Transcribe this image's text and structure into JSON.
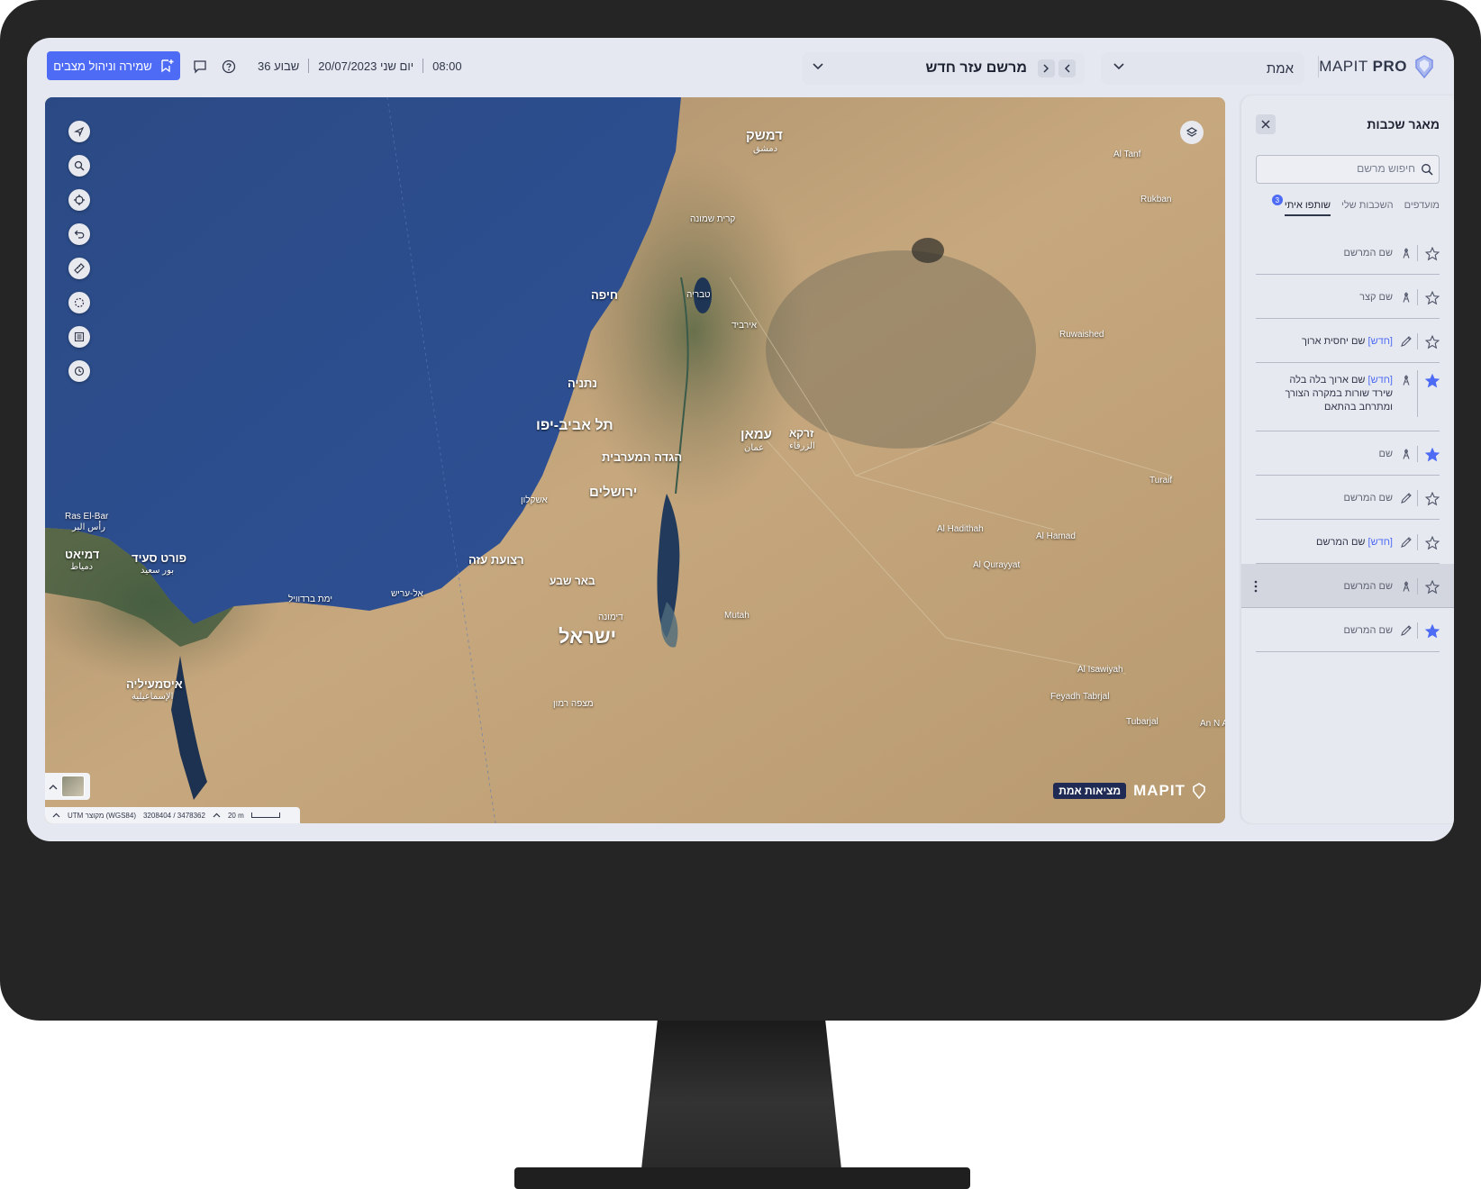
{
  "app": {
    "logo_brand": "MAPIT",
    "logo_suffix": "PRO"
  },
  "header": {
    "org_select_label": "אמת",
    "project_title": "מרשם עזר חדש",
    "time": "08:00",
    "date": "20/07/2023 יום שני",
    "week": "שבוע 36",
    "save_button_label": "שמירה וניהול מצבים"
  },
  "map": {
    "brand_word": "MAPIT",
    "brand_tag": "מציאות אמת",
    "coords_system": "UTM מקוצר (WGS84)",
    "coords_value": "3208404 / 3478362",
    "scale_label": "20 m",
    "labels": {
      "damascus": "דמשק",
      "damascus_ar": "دمشق",
      "haifa": "חיפה",
      "tiberias": "טבריה",
      "netanya": "נתניה",
      "tel_aviv": "תל אביב-יפו",
      "jerusalem": "ירושלים",
      "west_bank": "הגדה המערבית",
      "amman": "עמאן",
      "amman_ar": "عمان",
      "zarqa": "זרקא",
      "zarqa_ar": "الزرقاء",
      "gaza_strip": "רצועת עזה",
      "beer_sheva": "באר שבע",
      "israel": "ישראל",
      "port_said": "פורט סעיד",
      "port_said_ar": "بور سعيد",
      "damietta": "דמיאט",
      "damietta_ar": "دمياط",
      "ismailia": "איסמעיליה",
      "ismailia_ar": "الإسماعيلية",
      "ras_el_bar": "Ras El-Bar",
      "ras_el_bar_ar": "رأس البر",
      "al_tanf": "Al Tanf",
      "rukban": "Rukban",
      "ruwaished": "Ruwaished",
      "al_hadithah": "Al Hadithah",
      "al_qurayyat": "Al Qurayyat",
      "al_hamad": "Al Hamad",
      "turaif": "Turaif",
      "al_isawiyah": "Al Isawiyah",
      "feyadh_tabrjal": "Feyadh Tabrjal",
      "tubarjal": "Tubarjal",
      "an_nabk": "An N Abu",
      "mutah": "Mutah",
      "mitzpe_ramon": "מצפה רמון",
      "dimona": "דימונה",
      "ashkelon": "אשקלון",
      "el_arish": "אל-עריש",
      "bardawil": "ימת ברדוויל",
      "irbid": "אירביד",
      "kiryat_shmona": "קרית שמונה",
      "zafar": "זרקא"
    }
  },
  "panel": {
    "title": "מאגר שכבות",
    "search_placeholder": "חיפוש מרשם",
    "tabs": [
      {
        "label": "מועדפים",
        "active": false
      },
      {
        "label": "השכבות שלי",
        "active": false
      },
      {
        "label": "שותפו איתי",
        "active": true,
        "badge": "3"
      }
    ],
    "new_tag": "[חדש]",
    "rows": [
      {
        "name": "שם המרשם",
        "is_new": false,
        "extra": "",
        "icon": "compass-icon",
        "starred": false,
        "selected": false
      },
      {
        "name": "שם קצר",
        "is_new": false,
        "extra": "",
        "icon": "compass-icon",
        "starred": false,
        "selected": false
      },
      {
        "name": "שם יחסית ארוך",
        "is_new": true,
        "extra": "",
        "icon": "pencil-icon",
        "starred": false,
        "selected": false
      },
      {
        "name": "שם ארוך בלה בלה",
        "is_new": true,
        "extra": "שירד שורות במקרה הצורך ומתרחב בהתאם",
        "icon": "compass-icon",
        "starred": true,
        "selected": false
      },
      {
        "name": "שם",
        "is_new": false,
        "extra": "",
        "icon": "compass-icon",
        "starred": true,
        "selected": false
      },
      {
        "name": "שם המרשם",
        "is_new": false,
        "extra": "",
        "icon": "pencil-icon",
        "starred": false,
        "selected": false
      },
      {
        "name": "שם המרשם",
        "is_new": true,
        "extra": "",
        "icon": "pencil-icon",
        "starred": false,
        "selected": false
      },
      {
        "name": "שם המרשם",
        "is_new": false,
        "extra": "",
        "icon": "compass-icon",
        "starred": false,
        "selected": true
      },
      {
        "name": "שם המרשם",
        "is_new": false,
        "extra": "",
        "icon": "pencil-icon",
        "starred": true,
        "selected": false
      }
    ]
  },
  "colors": {
    "accent": "#4d6bf5",
    "screen_bg": "#e5e8f0",
    "sea": "#2f4f8a",
    "desert": "#b99c74"
  }
}
